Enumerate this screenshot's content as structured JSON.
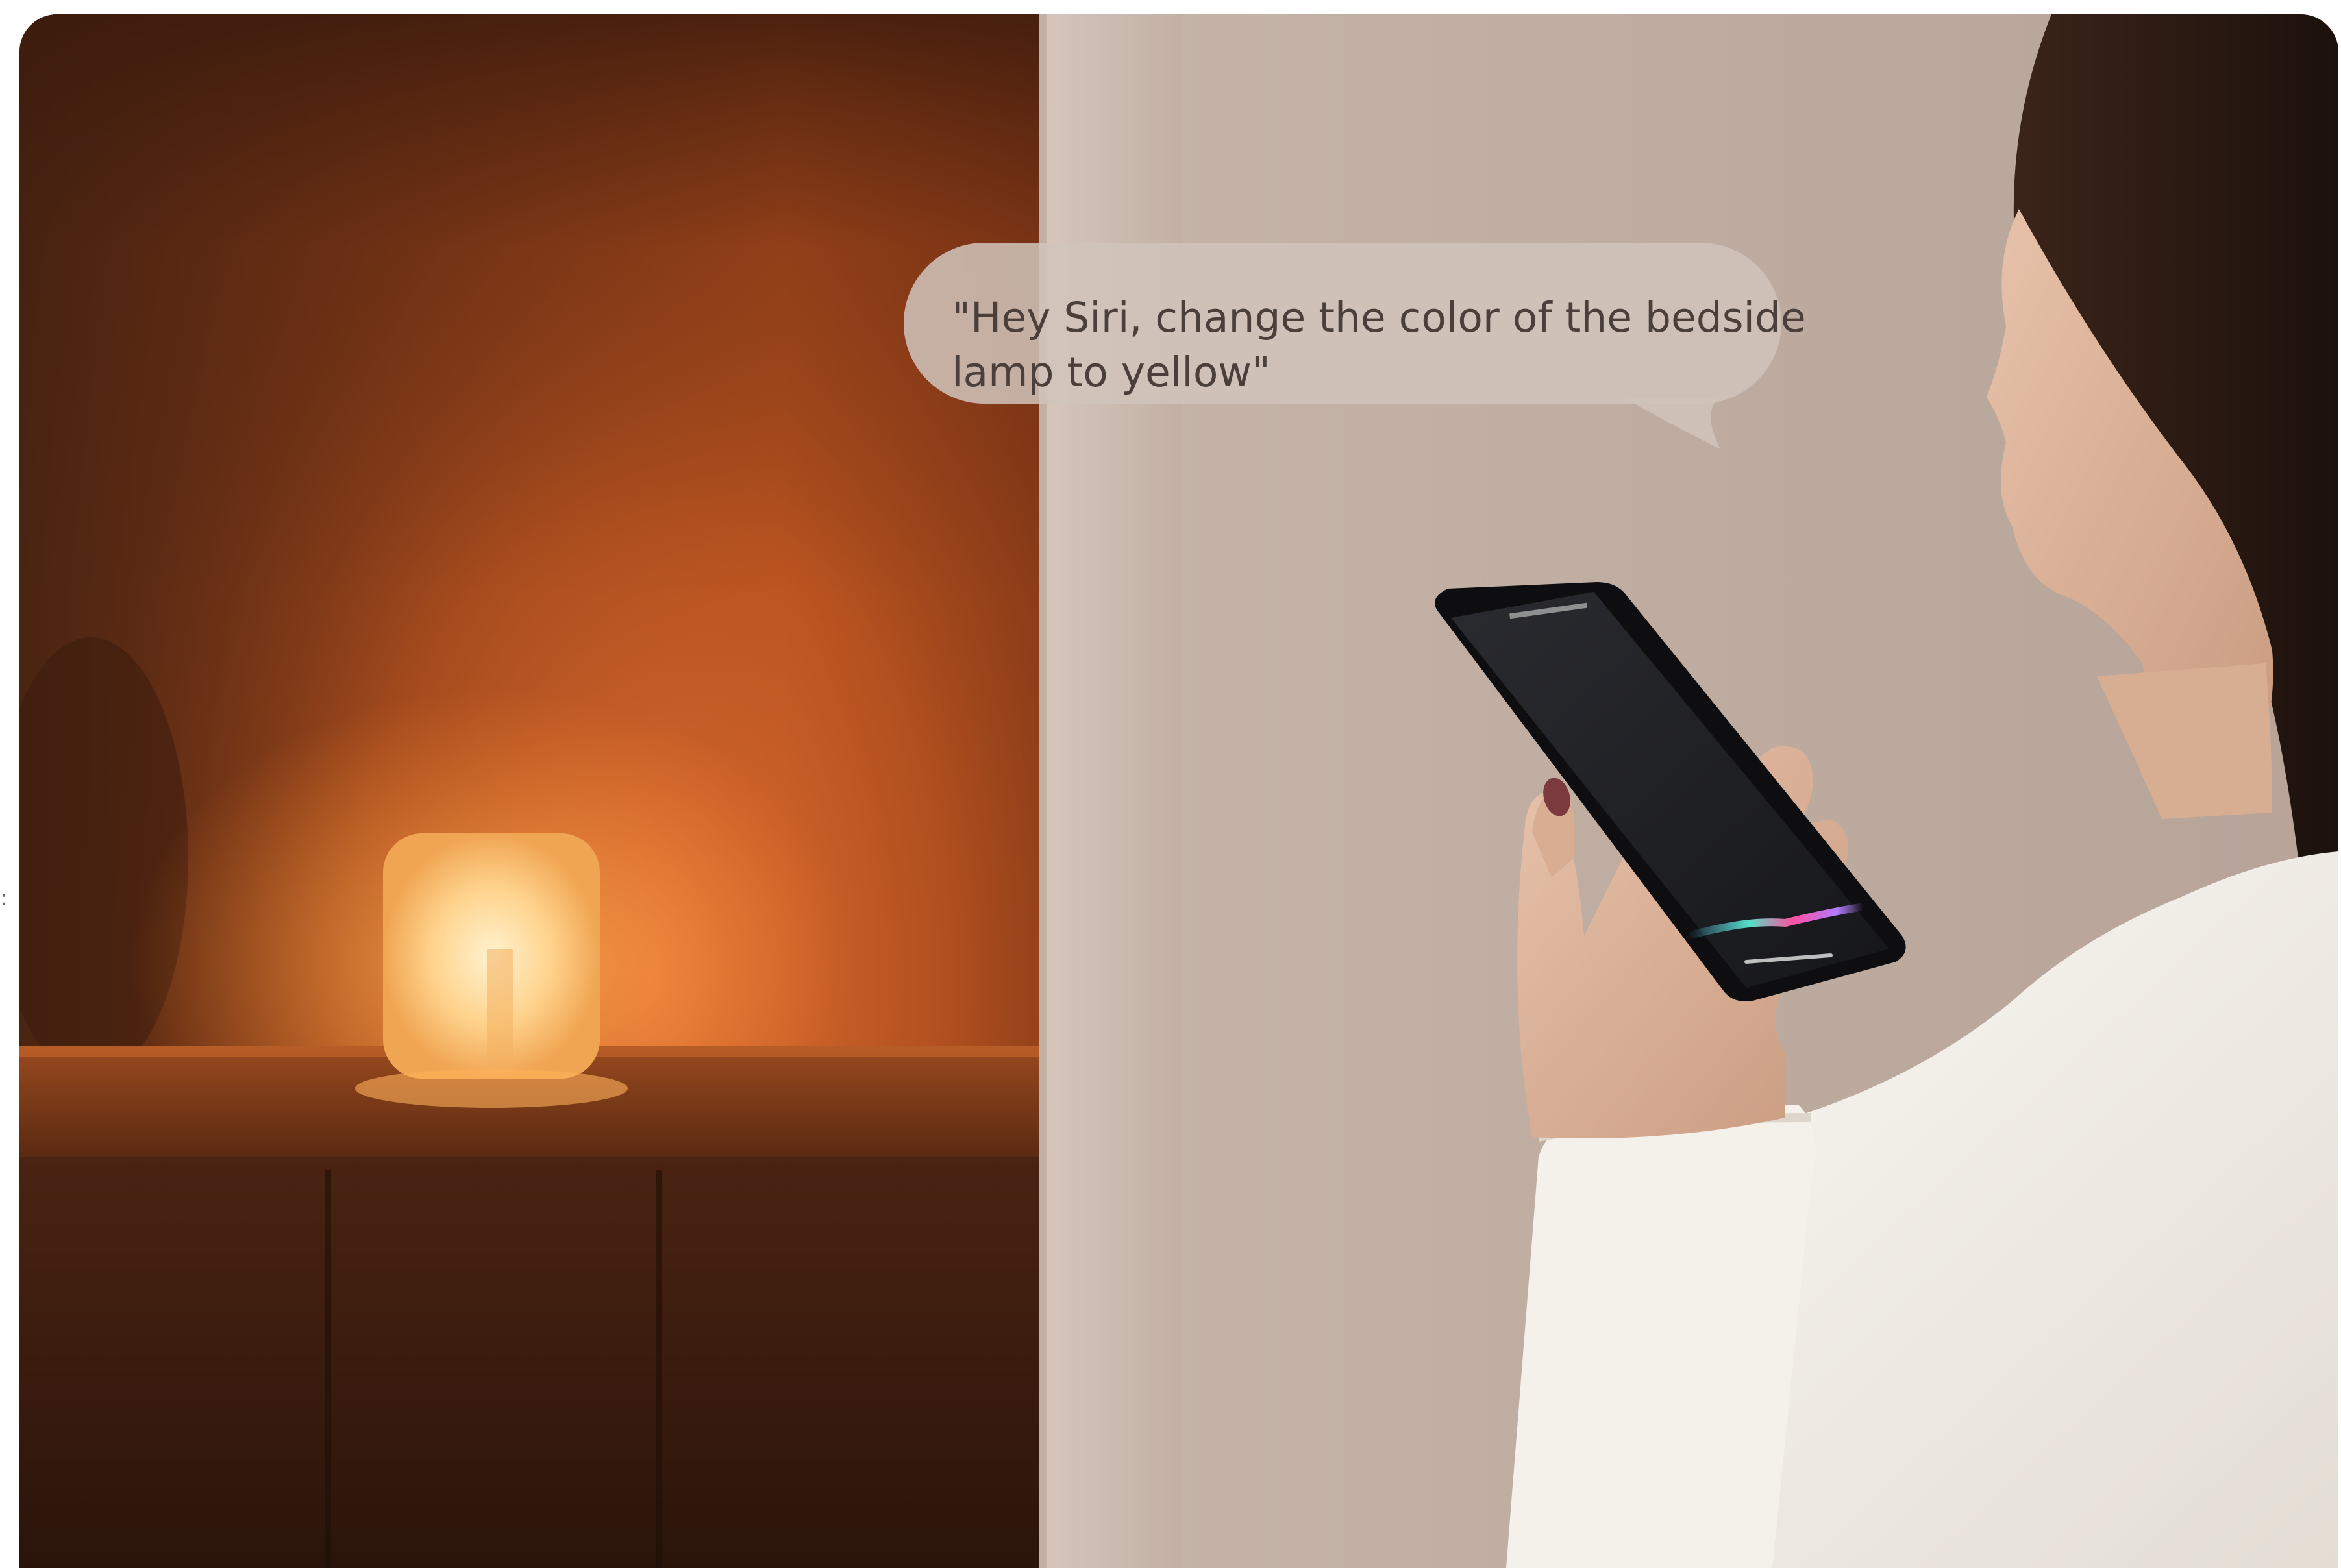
{
  "scene": {
    "description_icons": [
      "bedside-lamp",
      "smartphone",
      "siri-wave",
      "speech-bubble"
    ],
    "colors": {
      "warm_wall": "#b4521e",
      "lamp_glow": "#ffe0a8",
      "neutral_wall": "#c9b8ad",
      "sweater": "#f1eee8",
      "hair": "#2a1a14",
      "phone": "#1b1b1e"
    }
  },
  "speech": {
    "text": "\"Hey Siri, change the color of the bedside\nlamp to yellow\""
  }
}
